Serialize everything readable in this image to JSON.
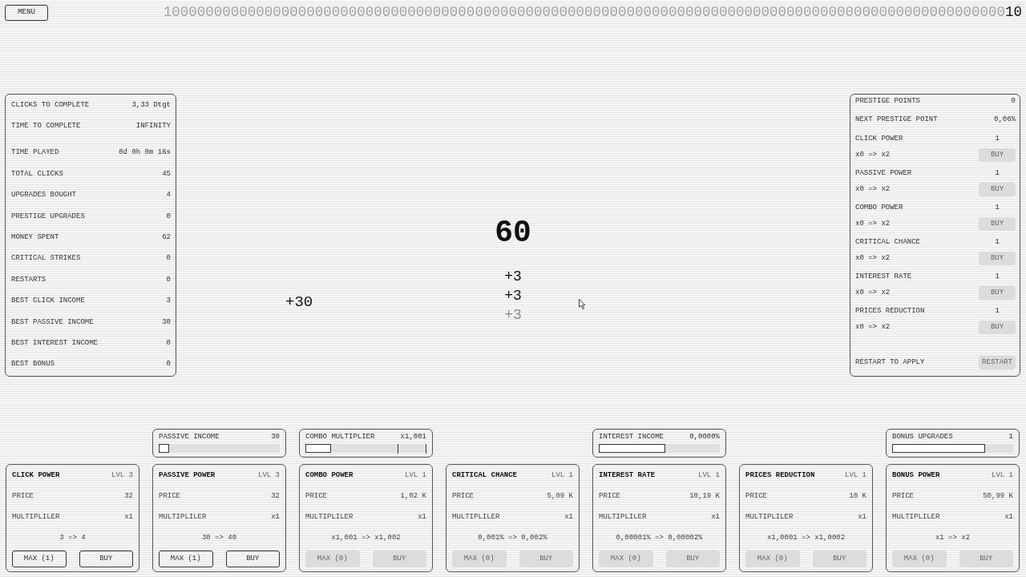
{
  "menu_button": "MENU",
  "goal_counter": {
    "target": "1000000000000000000000000000000000000000000000000000000000000000000000000000000000000000000000000000",
    "current": "10"
  },
  "stats_panel": {
    "completion": [
      {
        "label": "CLICKS TO COMPLETE",
        "value": "3,33 Dtgt"
      },
      {
        "label": "TIME TO COMPLETE",
        "value": "INFINITY"
      }
    ],
    "stats": [
      {
        "label": "TIME PLAYED",
        "value": "0d 0h 0m 16s"
      },
      {
        "label": "TOTAL CLICKS",
        "value": "45"
      },
      {
        "label": "UPGRADES BOUGHT",
        "value": "4"
      },
      {
        "label": "PRESTIGE UPGRADES",
        "value": "0"
      },
      {
        "label": "MONEY SPENT",
        "value": "62"
      },
      {
        "label": "CRITICAL STRIKES",
        "value": "0"
      },
      {
        "label": "RESTARTS",
        "value": "0"
      },
      {
        "label": "BEST CLICK INCOME",
        "value": "3"
      },
      {
        "label": "BEST PASSIVE INCOME",
        "value": "30"
      },
      {
        "label": "BEST INTEREST INCOME",
        "value": "0"
      },
      {
        "label": "BEST BONUS",
        "value": "0"
      }
    ]
  },
  "center": {
    "money": "60",
    "click_popups": [
      {
        "text": "+3",
        "faded": false
      },
      {
        "text": "+3",
        "faded": false
      },
      {
        "text": "+3",
        "faded": true
      }
    ],
    "passive_popup": {
      "text": "+30",
      "faded": false
    }
  },
  "prestige_panel": {
    "points": {
      "label": "PRESTIGE POINTS",
      "value": "0"
    },
    "next_point": {
      "label": "NEXT PRESTIGE POINT",
      "value": "0,06%"
    },
    "upgrades": [
      {
        "name": "CLICK POWER",
        "level": "1",
        "effect": "x0 => x2",
        "button": {
          "label": "BUY",
          "disabled": true
        }
      },
      {
        "name": "PASSIVE POWER",
        "level": "1",
        "effect": "x0 => x2",
        "button": {
          "label": "BUY",
          "disabled": true
        }
      },
      {
        "name": "COMBO POWER",
        "level": "1",
        "effect": "x0 => x2",
        "button": {
          "label": "BUY",
          "disabled": true
        }
      },
      {
        "name": "CRITICAL CHANCE",
        "level": "1",
        "effect": "x0 => x2",
        "button": {
          "label": "BUY",
          "disabled": true
        }
      },
      {
        "name": "INTEREST RATE",
        "level": "1",
        "effect": "x0 => x2",
        "button": {
          "label": "BUY",
          "disabled": true
        }
      },
      {
        "name": "PRICES REDUCTION",
        "level": "1",
        "effect": "x0 => x2",
        "button": {
          "label": "BUY",
          "disabled": true
        }
      }
    ],
    "restart": {
      "label": "RESTART TO APPLY",
      "button": {
        "label": "RESTART",
        "disabled": true
      }
    }
  },
  "bottom_columns": [
    {
      "upgrade": {
        "title": "CLICK POWER",
        "level_label": "LVL 3",
        "price_label": "PRICE",
        "price": "32",
        "multiplier_label": "MULTIPLILER",
        "multiplier": "x1",
        "effect": "3 => 4",
        "buttons": [
          {
            "label": "MAX (1)",
            "disabled": false
          },
          {
            "label": "BUY",
            "disabled": false
          }
        ]
      }
    },
    {
      "indicator": {
        "label": "PASSIVE INCOME",
        "value": "30",
        "kind": "bar",
        "level": 0.085
      },
      "upgrade": {
        "title": "PASSIVE POWER",
        "level_label": "LVL 3",
        "price_label": "PRICE",
        "price": "32",
        "multiplier_label": "MULTIPLILER",
        "multiplier": "x1",
        "effect": "30 => 40",
        "buttons": [
          {
            "label": "MAX (1)",
            "disabled": false
          },
          {
            "label": "BUY",
            "disabled": false
          }
        ]
      }
    },
    {
      "indicator": {
        "label": "COMBO MULTIPLIER",
        "value": "x1,001",
        "kind": "combo",
        "level": 0.21
      },
      "upgrade": {
        "title": "COMBO POWER",
        "level_label": "LVL 1",
        "price_label": "PRICE",
        "price": "1,02 K",
        "multiplier_label": "MULTIPLILER",
        "multiplier": "x1",
        "effect": "x1,001 => x1,002",
        "buttons": [
          {
            "label": "MAX (0)",
            "disabled": true
          },
          {
            "label": "BUY",
            "disabled": true
          }
        ]
      }
    },
    {
      "upgrade": {
        "title": "CRITICAL CHANCE",
        "level_label": "LVL 1",
        "price_label": "PRICE",
        "price": "5,09 K",
        "multiplier_label": "MULTIPLILER",
        "multiplier": "x1",
        "effect": "0,001% => 0,002%",
        "buttons": [
          {
            "label": "MAX (0)",
            "disabled": true
          },
          {
            "label": "BUY",
            "disabled": true
          }
        ]
      }
    },
    {
      "indicator": {
        "label": "INTEREST INCOME",
        "value": "0,0000%",
        "kind": "bar",
        "level": 0.55
      },
      "upgrade": {
        "title": "INTEREST RATE",
        "level_label": "LVL 1",
        "price_label": "PRICE",
        "price": "10,19 K",
        "multiplier_label": "MULTIPLILER",
        "multiplier": "x1",
        "effect": "0,00001% => 0,00002%",
        "buttons": [
          {
            "label": "MAX (0)",
            "disabled": true
          },
          {
            "label": "BUY",
            "disabled": true
          }
        ]
      }
    },
    {
      "upgrade": {
        "title": "PRICES REDUCTION",
        "level_label": "LVL 1",
        "price_label": "PRICE",
        "price": "10 K",
        "multiplier_label": "MULTIPLILER",
        "multiplier": "x1",
        "effect": "x1,0001 => x1,0002",
        "buttons": [
          {
            "label": "MAX (0)",
            "disabled": true
          },
          {
            "label": "BUY",
            "disabled": true
          }
        ]
      }
    },
    {
      "indicator": {
        "label": "BONUS UPGRADES",
        "value": "1",
        "kind": "bar",
        "level": 0.77
      },
      "upgrade": {
        "title": "BONUS POWER",
        "level_label": "LVL 1",
        "price_label": "PRICE",
        "price": "50,99 K",
        "multiplier_label": "MULTIPLILER",
        "multiplier": "x1",
        "effect": "x1 => x2",
        "buttons": [
          {
            "label": "MAX (0)",
            "disabled": true
          },
          {
            "label": "BUY",
            "disabled": true
          }
        ]
      }
    }
  ]
}
